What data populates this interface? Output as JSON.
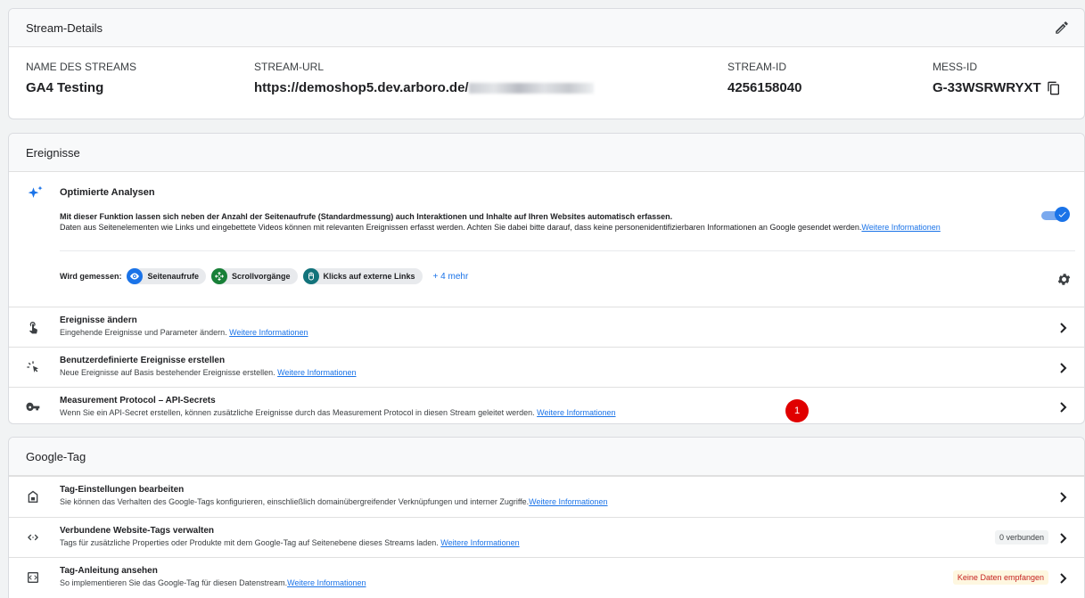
{
  "stream": {
    "header": "Stream-Details",
    "name_label": "NAME DES STREAMS",
    "name_value": "GA4 Testing",
    "url_label": "STREAM-URL",
    "url_value": "https://demoshop5.dev.arboro.de/",
    "id_label": "STREAM-ID",
    "id_value": "4256158040",
    "mess_label": "MESS-ID",
    "mess_value": "G-33WSRWRYXT"
  },
  "events": {
    "header": "Ereignisse",
    "optimized": {
      "title": "Optimierte Analysen",
      "desc1": "Mit dieser Funktion lassen sich neben der Anzahl der Seitenaufrufe (Standardmessung) auch Interaktionen und Inhalte auf Ihren Websites automatisch erfassen.",
      "desc2": "Daten aus Seitenelementen wie Links und eingebettete Videos können mit relevanten Ereignissen erfasst werden. Achten Sie dabei bitte darauf, dass keine personenidentifizierbaren Informationen an Google gesendet werden.",
      "desc2_link": "Weitere Informationen",
      "toggle_on": true,
      "measured_label": "Wird gemessen:",
      "chips": [
        "Seitenaufrufe",
        "Scrollvorgänge",
        "Klicks auf externe Links"
      ],
      "more": "+ 4 mehr"
    },
    "rows": [
      {
        "title": "Ereignisse ändern",
        "desc": "Eingehende Ereignisse und Parameter ändern.",
        "link": "Weitere Informationen"
      },
      {
        "title": "Benutzerdefinierte Ereignisse erstellen",
        "desc": "Neue Ereignisse auf Basis bestehender Ereignisse erstellen.",
        "link": "Weitere Informationen"
      },
      {
        "title": "Measurement Protocol – API-Secrets",
        "desc": "Wenn Sie ein API-Secret erstellen, können zusätzliche Ereignisse durch das Measurement Protocol in diesen Stream geleitet werden.",
        "link": "Weitere Informationen",
        "badge": "1"
      }
    ]
  },
  "tag": {
    "header": "Google-Tag",
    "rows": [
      {
        "title": "Tag-Einstellungen bearbeiten",
        "desc": "Sie können das Verhalten des Google-Tags konfigurieren, einschließlich domainübergreifender Verknüpfungen und interner Zugriffe.",
        "link": "Weitere Informationen"
      },
      {
        "title": "Verbundene Website-Tags verwalten",
        "desc": "Tags für zusätzliche Properties oder Produkte mit dem Google-Tag auf Seitenebene dieses Streams laden.",
        "link": "Weitere Informationen",
        "status": "0 verbunden"
      },
      {
        "title": "Tag-Anleitung ansehen",
        "desc": "So implementieren Sie das Google-Tag für diesen Datenstream.",
        "link": "Weitere Informationen",
        "status": "Keine Daten empfangen"
      }
    ]
  },
  "colors": {
    "accent": "#1a73e8",
    "badge_red": "#e00000",
    "warn_text": "#c5221f"
  },
  "icons": [
    "pencil-icon",
    "copy-icon",
    "sparkle-icon",
    "eye-icon",
    "scroll-icon",
    "mouse-icon",
    "gear-icon",
    "touch-icon",
    "cursor-click-icon",
    "key-icon",
    "tag-settings-icon",
    "code-arrows-icon",
    "code-box-icon",
    "chevron-right-icon"
  ]
}
